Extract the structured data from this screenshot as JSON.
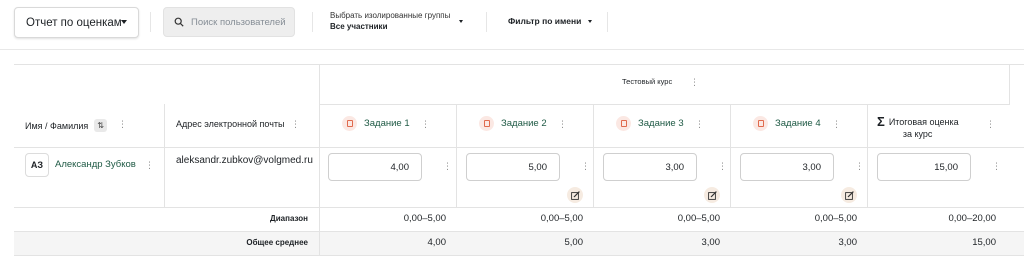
{
  "toolbar": {
    "report_select": "Отчет по оценкам",
    "search_placeholder": "Поиск пользователей",
    "groups_label": "Выбрать изолированные группы",
    "groups_value": "Все участники",
    "name_filter": "Фильтр по имени"
  },
  "table": {
    "course_title": "Тестовый курс",
    "col_name": "Имя / Фамилия",
    "col_email": "Адрес электронной почты",
    "assignments": [
      "Задание 1",
      "Задание 2",
      "Задание 3",
      "Задание 4"
    ],
    "total_header": "Итоговая оценка за курс",
    "total_header_line1": "Итоговая оценка",
    "total_header_line2": "за курс",
    "student": {
      "initials": "АЗ",
      "name": "Александр Зубков",
      "email": "aleksandr.zubkov@volgmed.ru",
      "grades": [
        "4,00",
        "5,00",
        "3,00",
        "3,00"
      ],
      "total": "15,00"
    },
    "range_label": "Диапазон",
    "ranges": [
      "0,00–5,00",
      "0,00–5,00",
      "0,00–5,00",
      "0,00–5,00",
      "0,00–20,00"
    ],
    "average_label": "Общее среднее",
    "averages": [
      "4,00",
      "5,00",
      "3,00",
      "3,00",
      "15,00"
    ]
  },
  "icons": {
    "search": "search-icon",
    "assignment": "assignment-icon",
    "edit": "edit-icon",
    "sort": "sort-icon",
    "sigma": "sigma-icon"
  },
  "colors": {
    "link": "#1f5a45",
    "assignment_icon": "#e06a4d"
  }
}
